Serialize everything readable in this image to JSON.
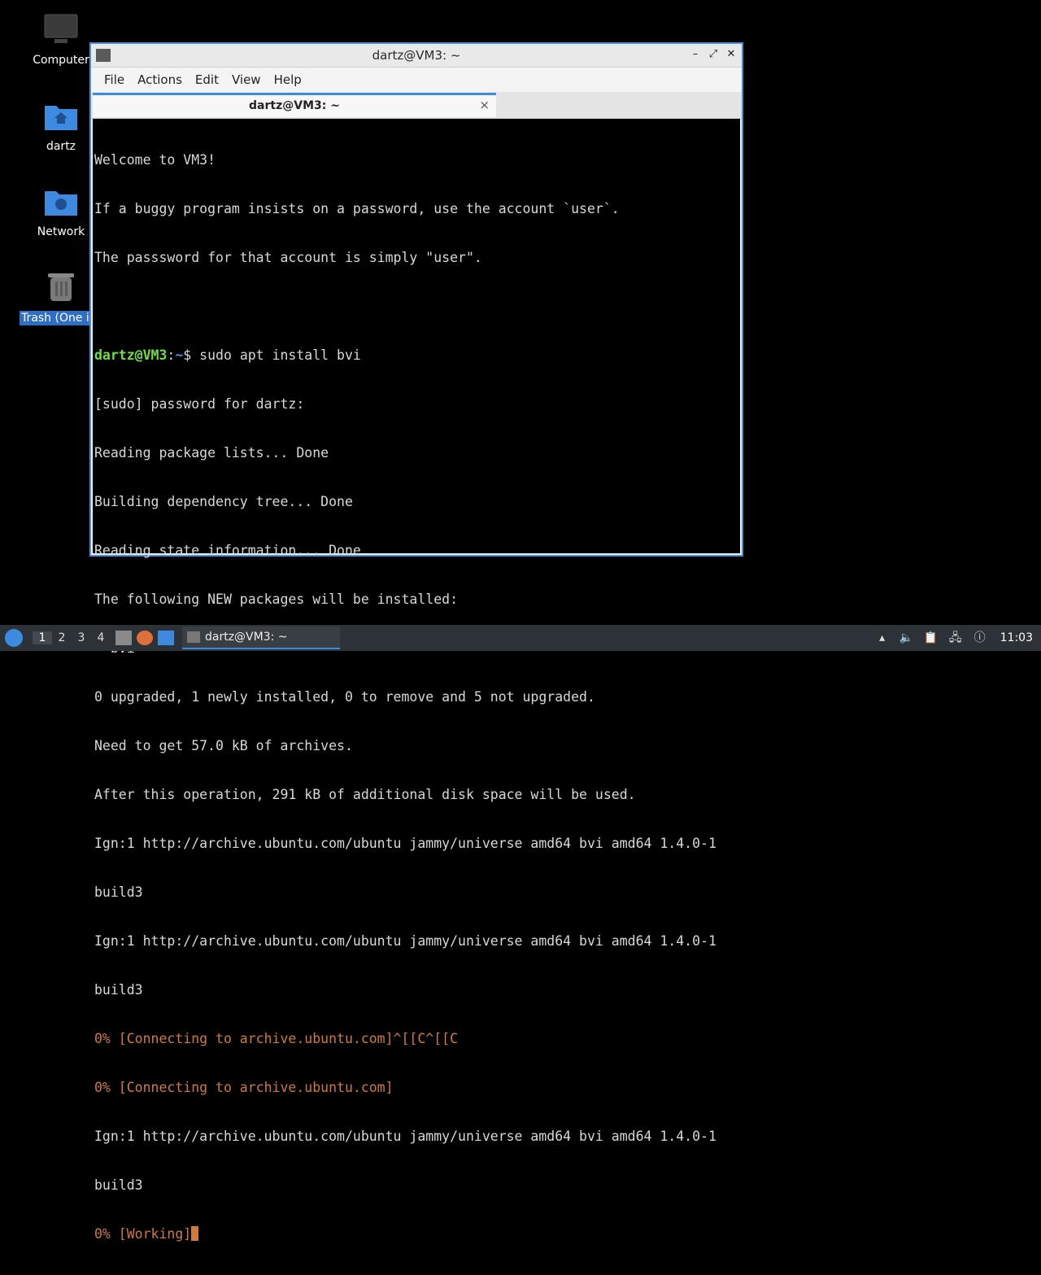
{
  "desktop": {
    "icons": [
      {
        "label": "Computer",
        "icon": "monitor-icon"
      },
      {
        "label": "dartz",
        "icon": "home-folder-icon"
      },
      {
        "label": "Network",
        "icon": "network-folder-icon"
      },
      {
        "label": "Trash (One ite",
        "icon": "trash-icon",
        "selected": true
      }
    ]
  },
  "window": {
    "title": "dartz@VM3: ~",
    "menu": [
      "File",
      "Actions",
      "Edit",
      "View",
      "Help"
    ],
    "tab_label": "dartz@VM3: ~",
    "tab_close": "×",
    "controls": {
      "minimize": "–",
      "maximize": "⤢",
      "close": "✕"
    }
  },
  "terminal": {
    "welcome": [
      "Welcome to VM3!",
      "If a buggy program insists on a password, use the account `user`.",
      "The passsword for that account is simply \"user\"."
    ],
    "prompt_user": "dartz@VM3",
    "prompt_path": "~",
    "prompt_cmd": "$ sudo apt install bvi",
    "output": [
      "[sudo] password for dartz:",
      "Reading package lists... Done",
      "Building dependency tree... Done",
      "Reading state information... Done",
      "The following NEW packages will be installed:",
      "  bvi",
      "0 upgraded, 1 newly installed, 0 to remove and 5 not upgraded.",
      "Need to get 57.0 kB of archives.",
      "After this operation, 291 kB of additional disk space will be used.",
      "Ign:1 http://archive.ubuntu.com/ubuntu jammy/universe amd64 bvi amd64 1.4.0-1",
      "build3",
      "Ign:1 http://archive.ubuntu.com/ubuntu jammy/universe amd64 bvi amd64 1.4.0-1",
      "build3"
    ],
    "progress1": "0% [Connecting to archive.ubuntu.com]^[[C^[[C",
    "progress2": "0% [Connecting to archive.ubuntu.com]",
    "output2": [
      "Ign:1 http://archive.ubuntu.com/ubuntu jammy/universe amd64 bvi amd64 1.4.0-1",
      "build3"
    ],
    "working": "0% [Working]"
  },
  "taskbar": {
    "workspaces": [
      "1",
      "2",
      "3",
      "4"
    ],
    "active_workspace": "1",
    "task_label": "dartz@VM3: ~",
    "clock": "11:03",
    "colors": {
      "accent": "#3d8be0",
      "prompt_user": "#6ae043",
      "progress": "#d17a3a"
    }
  }
}
